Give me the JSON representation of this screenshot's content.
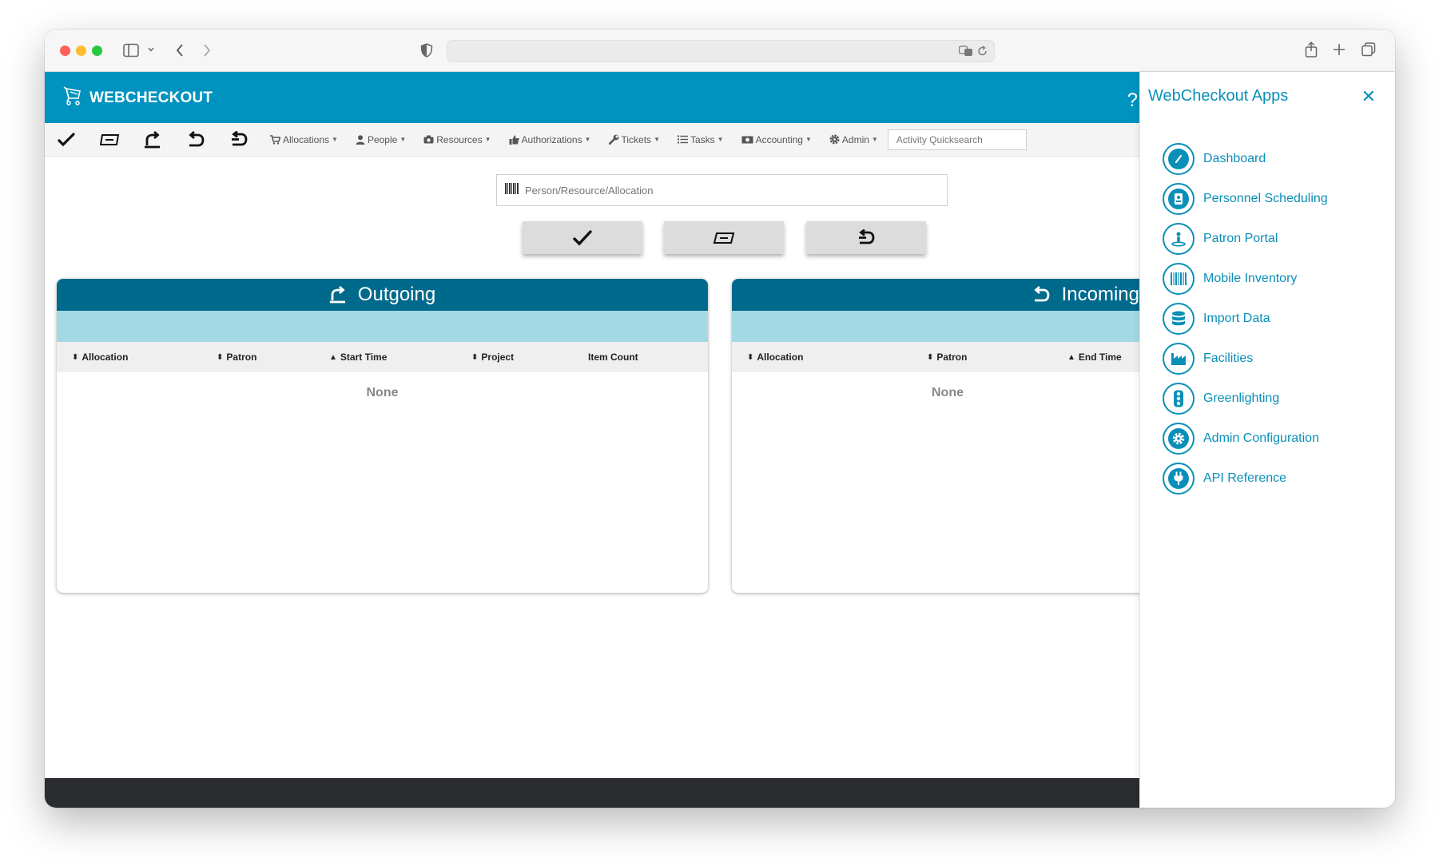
{
  "app": {
    "brand": "WEBCHECKOUT",
    "help_label": "?"
  },
  "nav": {
    "menus": [
      {
        "label": "Allocations",
        "icon": "cart-icon"
      },
      {
        "label": "People",
        "icon": "person-icon"
      },
      {
        "label": "Resources",
        "icon": "camera-icon"
      },
      {
        "label": "Authorizations",
        "icon": "thumbs-up-icon"
      },
      {
        "label": "Tickets",
        "icon": "wrench-icon"
      },
      {
        "label": "Tasks",
        "icon": "list-icon"
      },
      {
        "label": "Accounting",
        "icon": "money-icon"
      },
      {
        "label": "Admin",
        "icon": "gear-icon"
      }
    ],
    "quicksearch_placeholder": "Activity Quicksearch"
  },
  "scan": {
    "placeholder": "Person/Resource/Allocation"
  },
  "outgoing": {
    "title": "Outgoing",
    "columns": [
      "Allocation",
      "Patron",
      "Start Time",
      "Project",
      "Item Count"
    ],
    "empty": "None"
  },
  "incoming": {
    "title": "Incoming",
    "columns": [
      "Allocation",
      "Patron",
      "End Time"
    ],
    "empty": "None"
  },
  "drawer": {
    "title": "WebCheckout Apps",
    "close": "✕",
    "items": [
      {
        "label": "Dashboard",
        "icon": "dashboard-icon"
      },
      {
        "label": "Personnel Scheduling",
        "icon": "badge-icon"
      },
      {
        "label": "Patron Portal",
        "icon": "portal-person-icon"
      },
      {
        "label": "Mobile Inventory",
        "icon": "barcode-icon"
      },
      {
        "label": "Import Data",
        "icon": "database-icon"
      },
      {
        "label": "Facilities",
        "icon": "factory-icon"
      },
      {
        "label": "Greenlighting",
        "icon": "traffic-light-icon"
      },
      {
        "label": "Admin Configuration",
        "icon": "gear-icon"
      },
      {
        "label": "API Reference",
        "icon": "plug-icon"
      }
    ]
  },
  "colors": {
    "brand": "#0093bf",
    "panel_header": "#006a8d",
    "panel_sub": "#a2d9e4",
    "drawer_accent": "#0a8fb8",
    "footer": "#2a2c30"
  }
}
